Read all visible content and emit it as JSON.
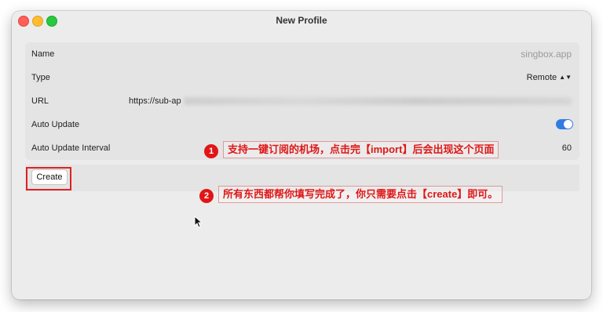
{
  "window": {
    "title": "New Profile"
  },
  "form": {
    "name": {
      "label": "Name",
      "placeholder": "singbox.app"
    },
    "type": {
      "label": "Type",
      "value": "Remote",
      "chevron": "⌃⌄"
    },
    "url": {
      "label": "URL",
      "value": "https://sub-ap"
    },
    "auto_update": {
      "label": "Auto Update",
      "enabled": true
    },
    "auto_update_interval": {
      "label": "Auto Update Interval",
      "value": "60"
    }
  },
  "actions": {
    "create_label": "Create"
  },
  "annotations": [
    {
      "number": "1",
      "text": "支持一键订阅的机场，点击完【import】后会出现这个页面"
    },
    {
      "number": "2",
      "text": "所有东西都帮你填写完成了，你只需要点击【create】即可。"
    }
  ],
  "colors": {
    "accent": "#2f7de1",
    "annotation_red": "#e01616"
  }
}
